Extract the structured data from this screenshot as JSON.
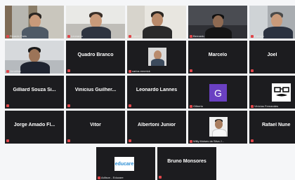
{
  "participants": [
    {
      "id": "r1c1",
      "name": "Ricardo Paris"
    },
    {
      "id": "r1c2",
      "name": "Leonardo"
    },
    {
      "id": "r1c3",
      "name": "Daniel T"
    },
    {
      "id": "r1c4",
      "name": "Bernardo"
    },
    {
      "id": "r1c5",
      "name": "Fabiano"
    },
    {
      "id": "r2c1",
      "name": "Jonathan"
    },
    {
      "id": "r2c2",
      "name": "Quadro Branco"
    },
    {
      "id": "r2c3",
      "name": "carlos emerick"
    },
    {
      "id": "r2c4",
      "name": "Marcelo"
    },
    {
      "id": "r2c5",
      "name": "Joel"
    },
    {
      "id": "r3c1",
      "name": "Gilliard Souza Si..."
    },
    {
      "id": "r3c2",
      "name": "Vinicius Guilher..."
    },
    {
      "id": "r3c3",
      "name": "Leonardo Lannes"
    },
    {
      "id": "r3c4",
      "name": "Gilberto",
      "avatar_letter": "G"
    },
    {
      "id": "r3c5",
      "name": "Vinícius Fernandes"
    },
    {
      "id": "r4c1",
      "name": "Jorge Amado Fl..."
    },
    {
      "id": "r4c2",
      "name": "Vitor"
    },
    {
      "id": "r4c3",
      "name": "Albertoni Junior"
    },
    {
      "id": "r4c4",
      "name": "Willy Moises da Silva J..."
    },
    {
      "id": "r4c5",
      "name": "Rafael Nune"
    },
    {
      "id": "r5c1",
      "name": "Adilson - Educare",
      "logo_text": "educare"
    },
    {
      "id": "r5c2",
      "name": "Bruno Monsores"
    }
  ],
  "colors": {
    "tile_bg": "#1c1c1f",
    "muted_mic": "#e0464a",
    "avatar_purple": "#6a40c2",
    "page_bg": "#f5f6f8"
  }
}
